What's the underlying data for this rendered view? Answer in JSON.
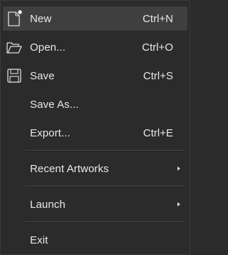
{
  "menu": {
    "items": [
      {
        "label": "New",
        "shortcut": "Ctrl+N",
        "icon": "new-document-icon"
      },
      {
        "label": "Open...",
        "shortcut": "Ctrl+O",
        "icon": "folder-open-icon"
      },
      {
        "label": "Save",
        "shortcut": "Ctrl+S",
        "icon": "floppy-disk-icon"
      },
      {
        "label": "Save As...",
        "shortcut": ""
      },
      {
        "label": "Export...",
        "shortcut": "Ctrl+E"
      },
      {
        "label": "Recent Artworks",
        "submenu": true
      },
      {
        "label": "Launch",
        "submenu": true
      },
      {
        "label": "Exit"
      }
    ]
  },
  "colors": {
    "background": "#2b2b2b",
    "highlight": "#3f3f3f",
    "text": "#e8e8e8",
    "separator": "#4a4a4a"
  }
}
